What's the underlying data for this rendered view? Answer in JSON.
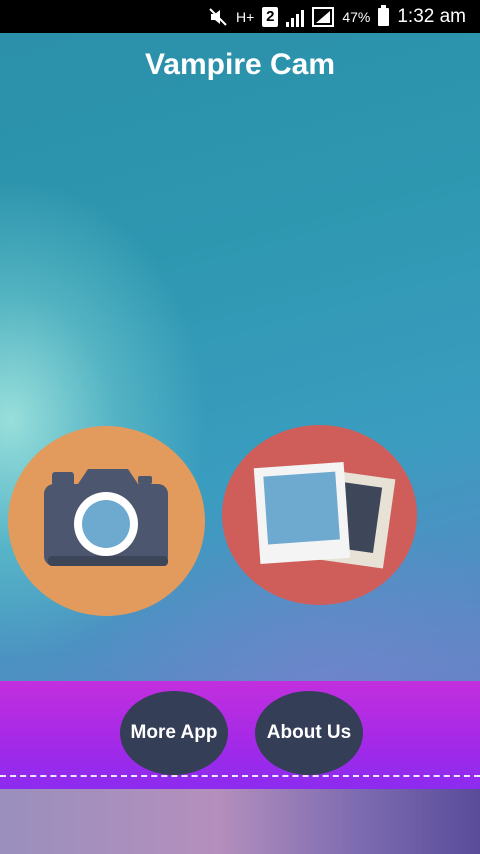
{
  "status_bar": {
    "network": "H+",
    "sim_slot": "2",
    "battery": "47%",
    "time": "1:32 am",
    "icons": [
      "mute-icon",
      "signal-icon",
      "battery-icon"
    ]
  },
  "app": {
    "title": "Vampire Cam"
  },
  "actions": {
    "camera_icon": "camera-icon",
    "gallery_icon": "gallery-icon",
    "camera_color": "#e29b5c",
    "gallery_color": "#cf5e5b"
  },
  "footer": {
    "more_app": "More App",
    "about_us": "About Us",
    "bar_color": "#b02ee4",
    "button_color": "#343e57"
  }
}
